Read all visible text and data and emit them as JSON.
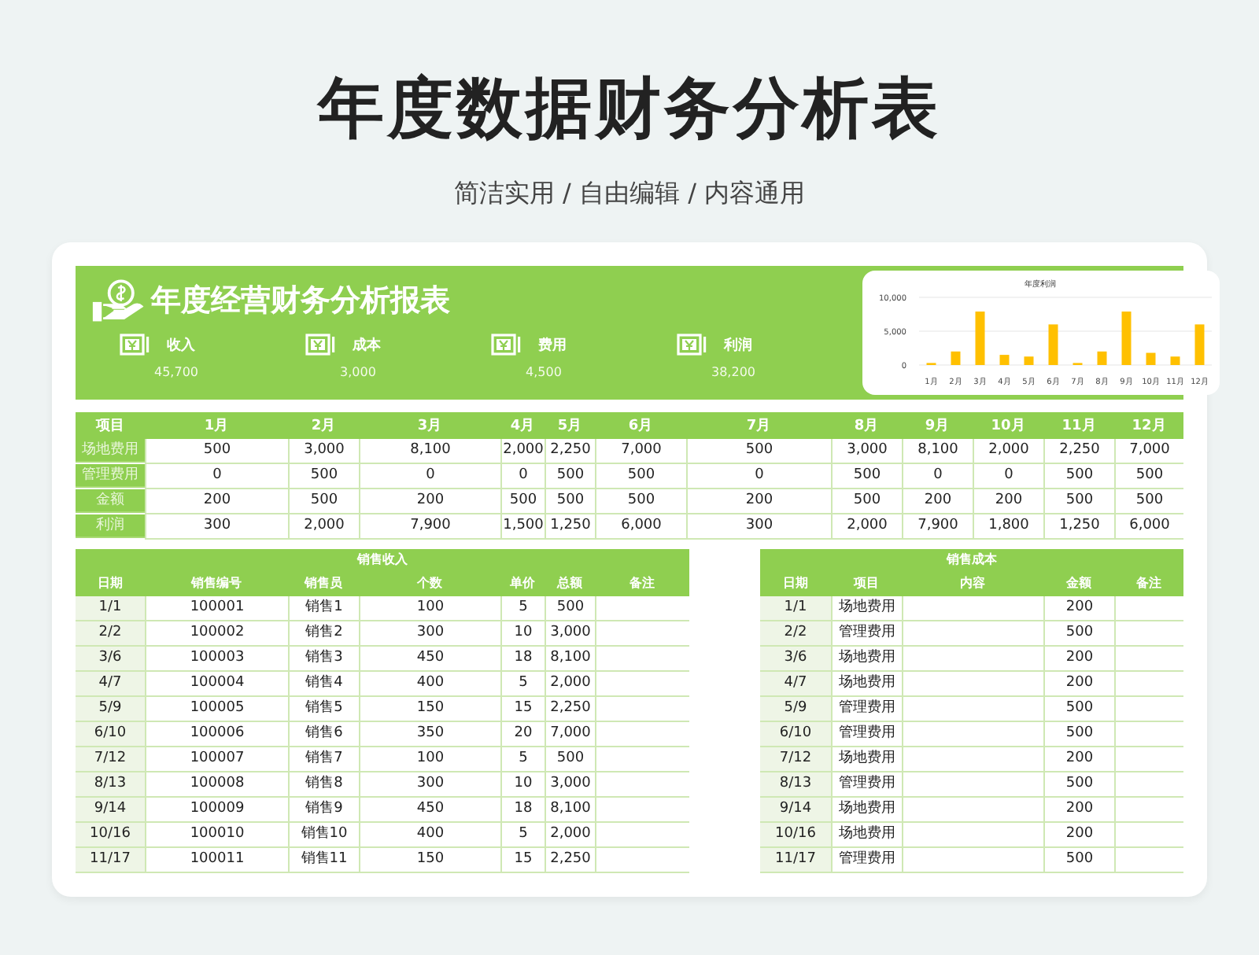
{
  "title": "年度数据财务分析表",
  "subtitle": "简洁实用 / 自由编辑 / 内容通用",
  "report": {
    "title": "年度经营财务分析报表",
    "kpis": [
      {
        "label": "收入",
        "value": "45,700"
      },
      {
        "label": "成本",
        "value": "3,000"
      },
      {
        "label": "费用",
        "value": "4,500"
      },
      {
        "label": "利润",
        "value": "38,200"
      }
    ],
    "chart_data": {
      "type": "bar",
      "title": "年度利润",
      "categories": [
        "1月",
        "2月",
        "3月",
        "4月",
        "5月",
        "6月",
        "7月",
        "8月",
        "9月",
        "10月",
        "11月",
        "12月"
      ],
      "series": [
        {
          "color": "#ffc000",
          "values": [
            300,
            2000,
            7900,
            1500,
            1250,
            6000,
            300,
            2000,
            7900,
            1800,
            1250,
            6000
          ]
        }
      ],
      "ylim": [
        0,
        10000
      ],
      "yticks": [
        {
          "value": 0,
          "label": "0"
        },
        {
          "value": 5000,
          "label": "5,000"
        },
        {
          "value": 10000,
          "label": "10,000"
        }
      ]
    }
  },
  "summary": {
    "columns": [
      "项目",
      "1月",
      "2月",
      "3月",
      "4月",
      "5月",
      "6月",
      "7月",
      "8月",
      "9月",
      "10月",
      "11月",
      "12月"
    ],
    "rows": [
      {
        "label": "场地费用",
        "values": [
          "500",
          "3,000",
          "8,100",
          "2,000",
          "2,250",
          "7,000",
          "500",
          "3,000",
          "8,100",
          "2,000",
          "2,250",
          "7,000"
        ]
      },
      {
        "label": "管理费用",
        "values": [
          "0",
          "500",
          "0",
          "0",
          "500",
          "500",
          "0",
          "500",
          "0",
          "0",
          "500",
          "500"
        ]
      },
      {
        "label": "金额",
        "values": [
          "200",
          "500",
          "200",
          "500",
          "500",
          "500",
          "200",
          "500",
          "200",
          "200",
          "500",
          "500"
        ]
      },
      {
        "label": "利润",
        "values": [
          "300",
          "2,000",
          "7,900",
          "1,500",
          "1,250",
          "6,000",
          "300",
          "2,000",
          "7,900",
          "1,800",
          "1,250",
          "6,000"
        ]
      }
    ]
  },
  "sales_income": {
    "title": "销售收入",
    "columns": [
      "日期",
      "销售编号",
      "销售员",
      "个数",
      "单价",
      "总额",
      "备注"
    ],
    "rows": [
      [
        "1/1",
        "100001",
        "销售1",
        "100",
        "5",
        "500"
      ],
      [
        "2/2",
        "100002",
        "销售2",
        "300",
        "10",
        "3,000"
      ],
      [
        "3/6",
        "100003",
        "销售3",
        "450",
        "18",
        "8,100"
      ],
      [
        "4/7",
        "100004",
        "销售4",
        "400",
        "5",
        "2,000"
      ],
      [
        "5/9",
        "100005",
        "销售5",
        "150",
        "15",
        "2,250"
      ],
      [
        "6/10",
        "100006",
        "销售6",
        "350",
        "20",
        "7,000"
      ],
      [
        "7/12",
        "100007",
        "销售7",
        "100",
        "5",
        "500"
      ],
      [
        "8/13",
        "100008",
        "销售8",
        "300",
        "10",
        "3,000"
      ],
      [
        "9/14",
        "100009",
        "销售9",
        "450",
        "18",
        "8,100"
      ],
      [
        "10/16",
        "100010",
        "销售10",
        "400",
        "5",
        "2,000"
      ],
      [
        "11/17",
        "100011",
        "销售11",
        "150",
        "15",
        "2,250"
      ]
    ]
  },
  "sales_cost": {
    "title": "销售成本",
    "columns": [
      "日期",
      "项目",
      "内容",
      "金额",
      "备注"
    ],
    "rows": [
      [
        "1/1",
        "场地费用",
        "",
        "200"
      ],
      [
        "2/2",
        "管理费用",
        "",
        "500"
      ],
      [
        "3/6",
        "场地费用",
        "",
        "200"
      ],
      [
        "4/7",
        "场地费用",
        "",
        "200"
      ],
      [
        "5/9",
        "管理费用",
        "",
        "500"
      ],
      [
        "6/10",
        "管理费用",
        "",
        "500"
      ],
      [
        "7/12",
        "场地费用",
        "",
        "200"
      ],
      [
        "8/13",
        "管理费用",
        "",
        "500"
      ],
      [
        "9/14",
        "场地费用",
        "",
        "200"
      ],
      [
        "10/16",
        "场地费用",
        "",
        "200"
      ],
      [
        "11/17",
        "管理费用",
        "",
        "500"
      ]
    ]
  }
}
